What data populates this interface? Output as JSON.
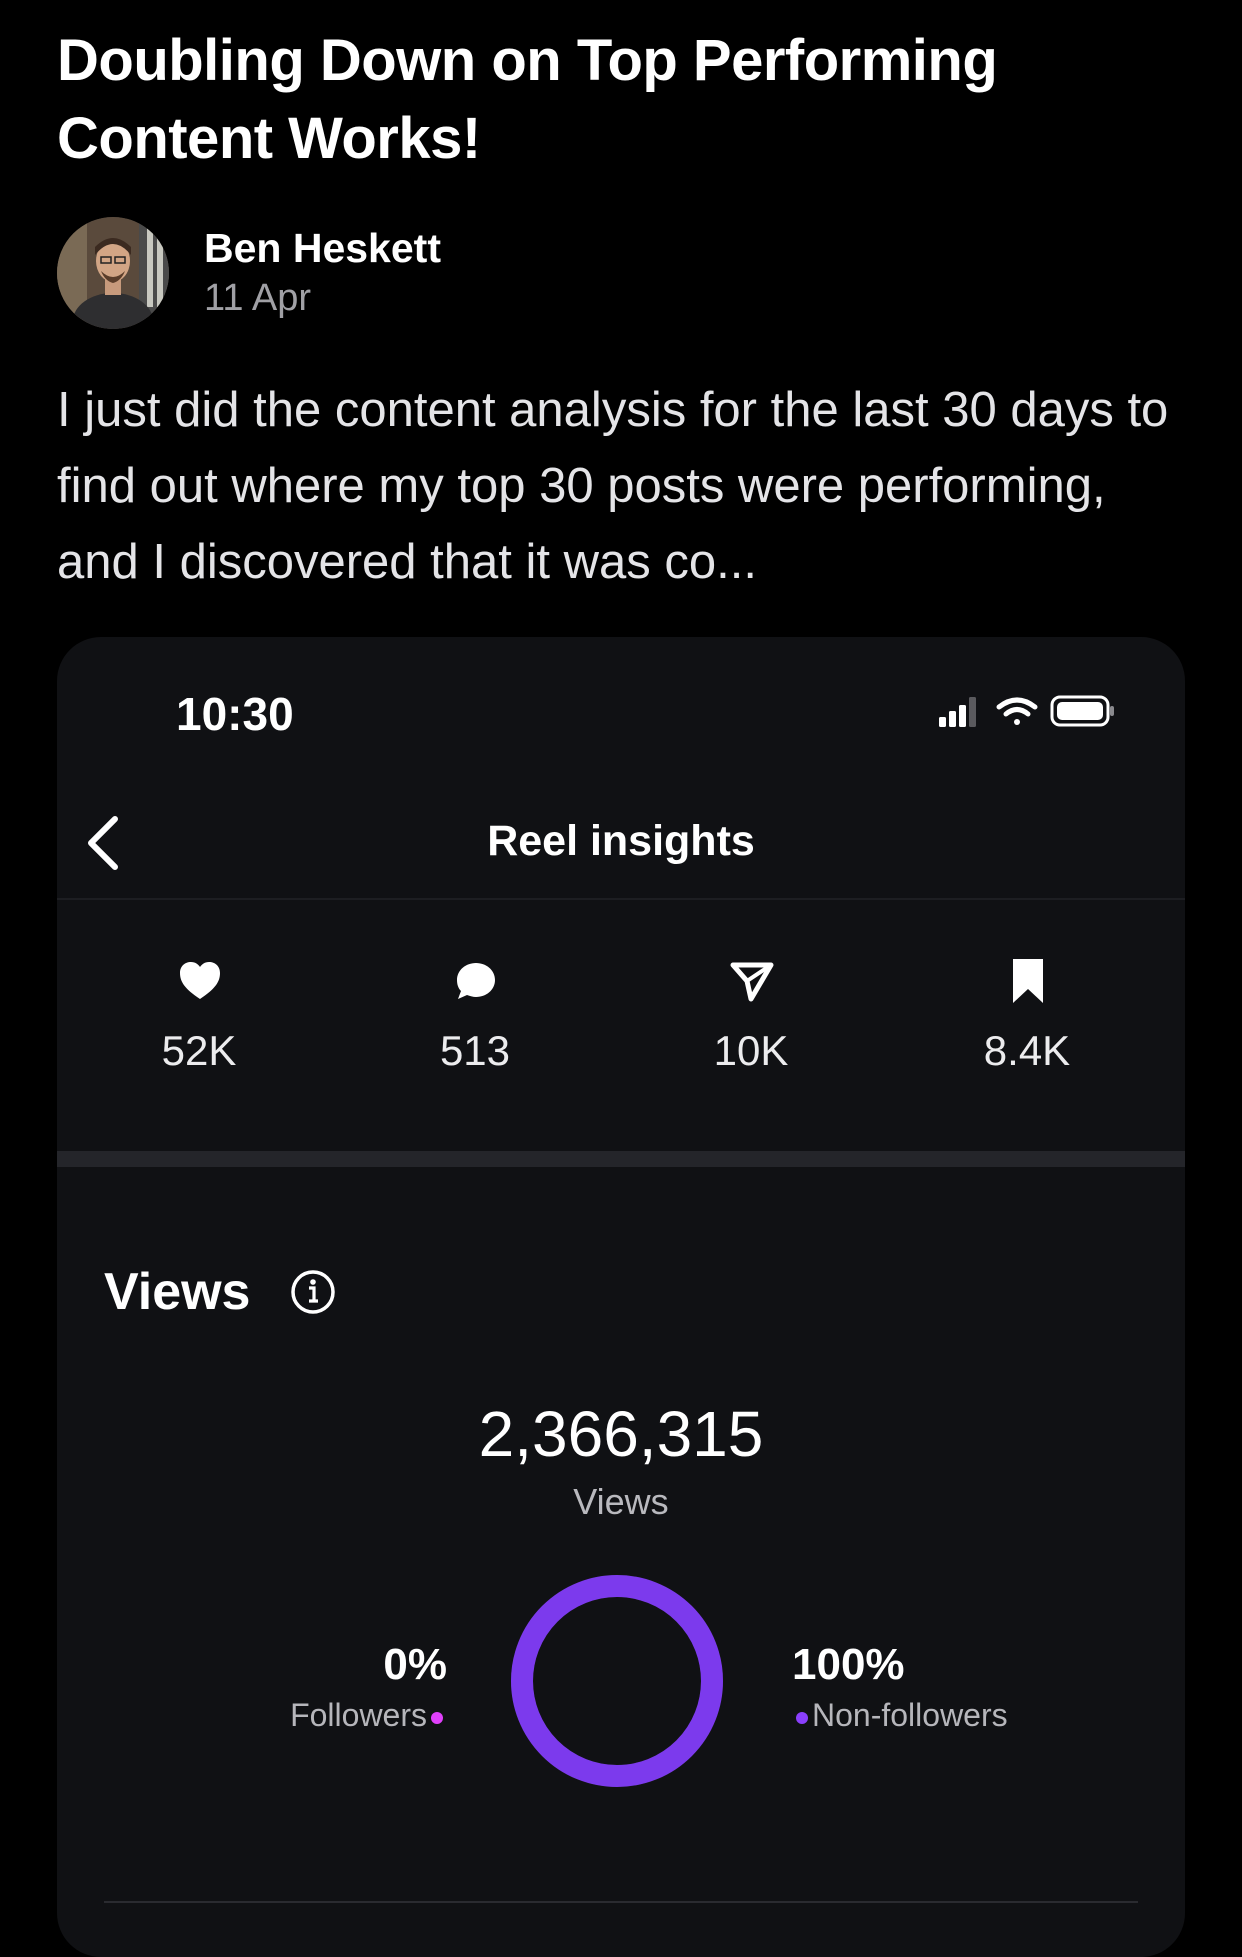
{
  "post": {
    "title": "Doubling Down on Top Performing Content Works!",
    "author": "Ben Heskett",
    "date": "11 Apr",
    "excerpt": "I just did the content analysis for the last 30 days to find out where my top 30 posts were performing, and I discovered that it was co..."
  },
  "screenshot": {
    "status_time": "10:30",
    "nav_title": "Reel insights",
    "stats": [
      {
        "icon": "heart-icon",
        "value": "52K"
      },
      {
        "icon": "comment-icon",
        "value": "513"
      },
      {
        "icon": "share-icon",
        "value": "10K"
      },
      {
        "icon": "bookmark-icon",
        "value": "8.4K"
      }
    ],
    "views": {
      "heading": "Views",
      "total": "2,366,315",
      "caption": "Views",
      "followers_pct": "0%",
      "followers_label": "Followers",
      "nonfollowers_pct": "100%",
      "nonfollowers_label": "Non-followers",
      "followers_fraction": 0.0,
      "nonfollowers_fraction": 1.0
    }
  },
  "colors": {
    "background": "#000000",
    "card": "#101114",
    "accent_purple": "#7c3aed",
    "followers_dot": "#e040fb",
    "nonfollowers_dot": "#8a3ffc"
  }
}
